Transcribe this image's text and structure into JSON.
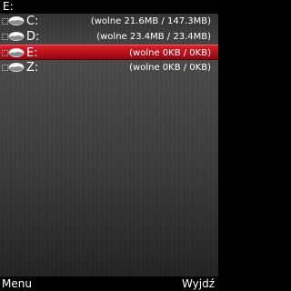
{
  "path": "E:",
  "drives": [
    {
      "label": "C:",
      "info": "(wolne 21.6MB / 147.3MB)",
      "selected": false
    },
    {
      "label": "D:",
      "info": "(wolne 23.4MB / 23.4MB)",
      "selected": false
    },
    {
      "label": "E:",
      "info": "(wolne 0KB / 0KB)",
      "selected": true
    },
    {
      "label": "Z:",
      "info": "(wolne 0KB / 0KB)",
      "selected": false
    }
  ],
  "softkeys": {
    "left": "Menu",
    "right": "Wyjdź"
  },
  "colors": {
    "selection": "#c8141e",
    "bar": "#000000",
    "text": "#ffffff"
  },
  "icons": {
    "drive": "hard-drive-icon",
    "expand": "tree-expand-icon"
  }
}
